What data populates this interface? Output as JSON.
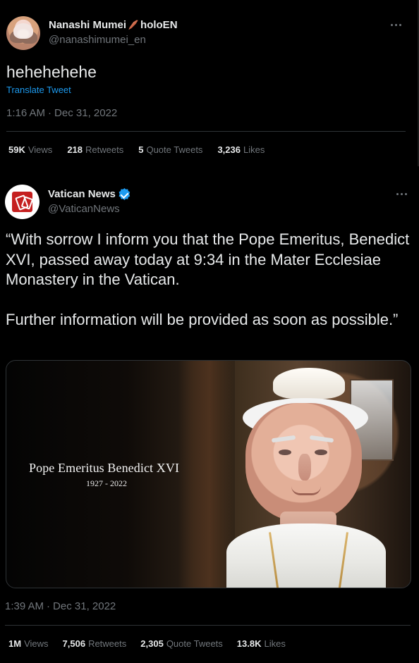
{
  "tweet1": {
    "author_name": "Nanashi Mumei",
    "author_suffix": "holoEN",
    "author_handle": "@nanashimumei_en",
    "text": "hehehehehe",
    "translate_label": "Translate Tweet",
    "time": "1:16 AM",
    "date": "Dec 31, 2022",
    "stats": [
      {
        "value": "59K",
        "label": "Views"
      },
      {
        "value": "218",
        "label": "Retweets"
      },
      {
        "value": "5",
        "label": "Quote Tweets"
      },
      {
        "value": "3,236",
        "label": "Likes"
      }
    ]
  },
  "tweet2": {
    "author_name": "Vatican News",
    "author_handle": "@VaticanNews",
    "text": "“With sorrow I inform you that the Pope Emeritus, Benedict XVI, passed away today at 9:34 in the Mater Ecclesiae Monastery in the Vatican.\n\nFurther information will be provided as soon as possible.”",
    "media": {
      "title": "Pope Emeritus Benedict XVI",
      "dates": "1927 - 2022"
    },
    "time": "1:39 AM",
    "date": "Dec 31, 2022",
    "stats": [
      {
        "value": "1M",
        "label": "Views"
      },
      {
        "value": "7,506",
        "label": "Retweets"
      },
      {
        "value": "2,305",
        "label": "Quote Tweets"
      },
      {
        "value": "13.8K",
        "label": "Likes"
      }
    ]
  },
  "colors": {
    "background": "#000000",
    "text": "#e7e9ea",
    "muted": "#71767b",
    "link": "#1d9bf0",
    "verified": "#1d9bf0",
    "divider": "#2f3336"
  },
  "icons": {
    "tweet1_avatar": "anime-character-avatar-icon",
    "tweet1_name_icon": "feather-icon",
    "tweet2_avatar": "vatican-news-logo-icon",
    "verified": "verified-badge-icon",
    "more": "more-horizontal-icon"
  }
}
